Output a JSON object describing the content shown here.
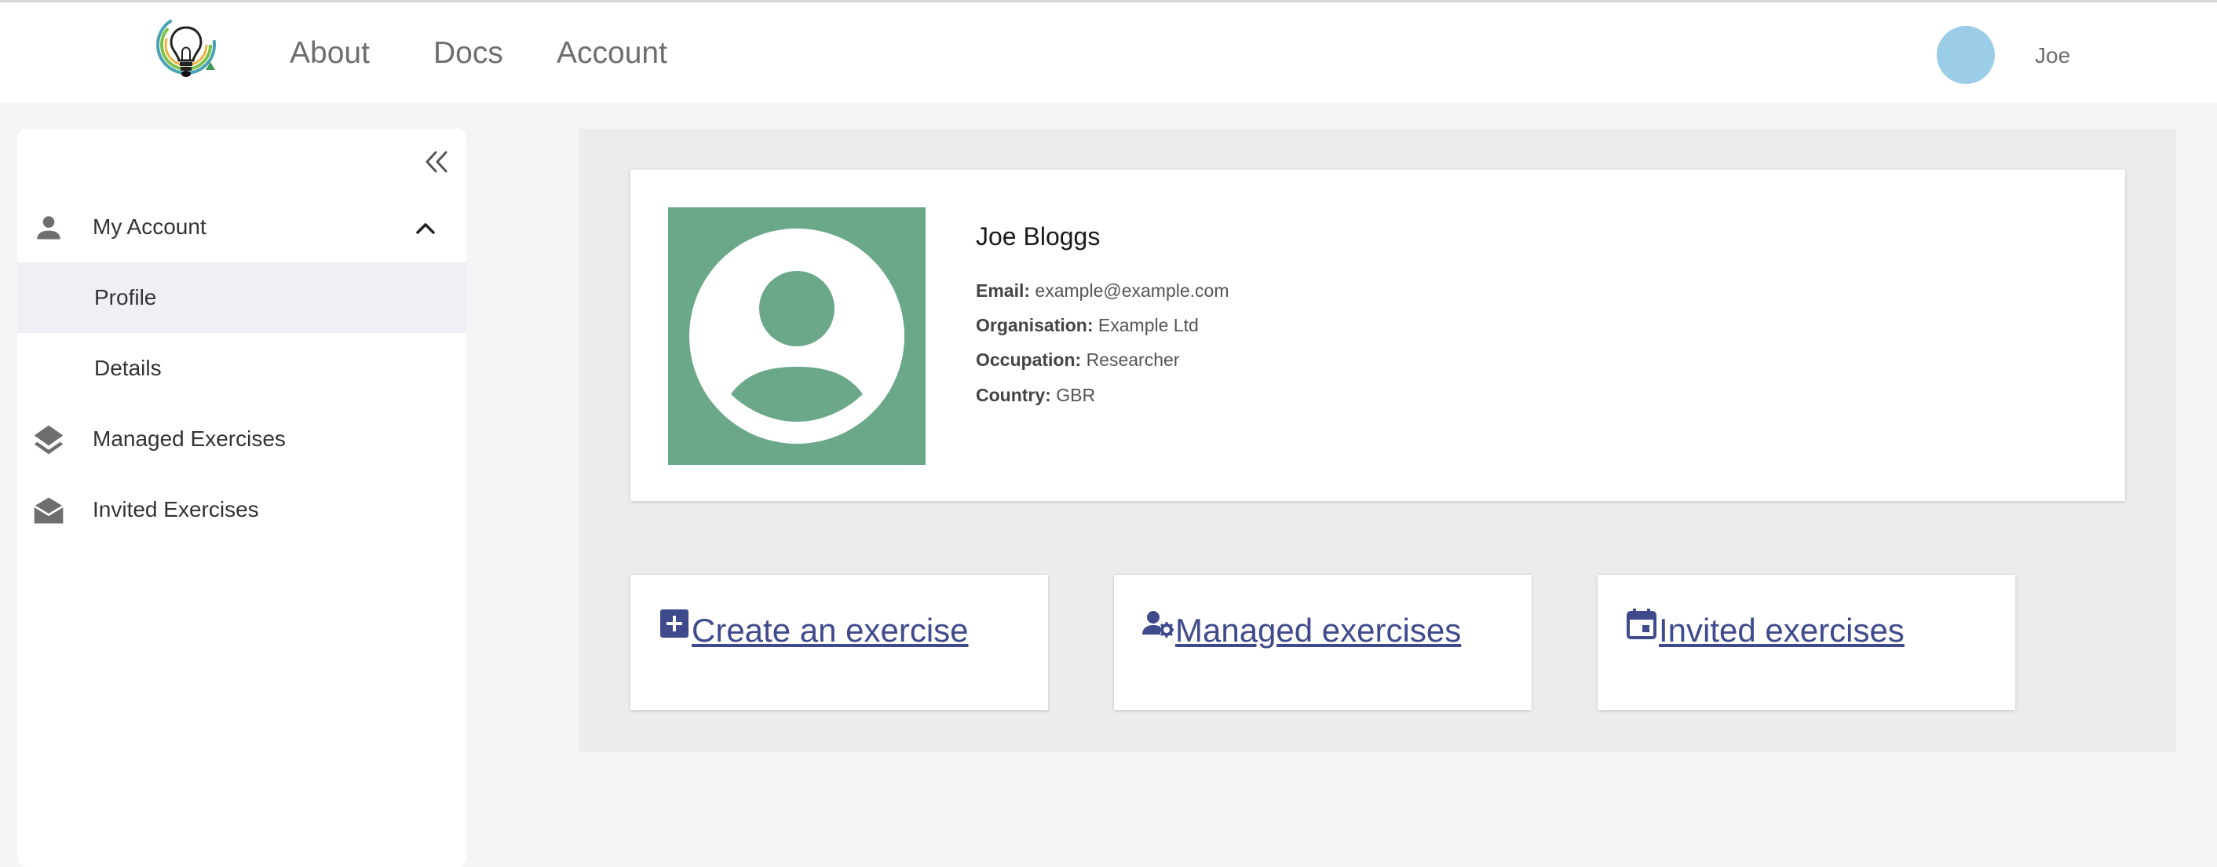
{
  "header": {
    "nav": [
      "About",
      "Docs",
      "Account"
    ],
    "user_name": "Joe"
  },
  "sidebar": {
    "sections": [
      {
        "label": "My Account",
        "icon": "person-icon",
        "expanded": true,
        "items": [
          {
            "label": "Profile",
            "active": true
          },
          {
            "label": "Details",
            "active": false
          }
        ]
      },
      {
        "label": "Managed Exercises",
        "icon": "layers-icon"
      },
      {
        "label": "Invited Exercises",
        "icon": "mail-open-icon"
      }
    ]
  },
  "profile": {
    "name": "Joe Bloggs",
    "fields": [
      {
        "label": "Email:",
        "value": "example@example.com"
      },
      {
        "label": "Organisation:",
        "value": "Example Ltd"
      },
      {
        "label": "Occupation:",
        "value": "Researcher"
      },
      {
        "label": "Country:",
        "value": "GBR"
      }
    ]
  },
  "actions": [
    {
      "label": "Create an exercise",
      "icon": "add-box-icon"
    },
    {
      "label": "Managed exercises",
      "icon": "manage-accounts-icon"
    },
    {
      "label": "Invited exercises",
      "icon": "calendar-icon"
    }
  ],
  "colors": {
    "accent_link": "#3f4a8c",
    "avatar_bg": "#6aa889",
    "user_dot": "#9ccde8"
  }
}
